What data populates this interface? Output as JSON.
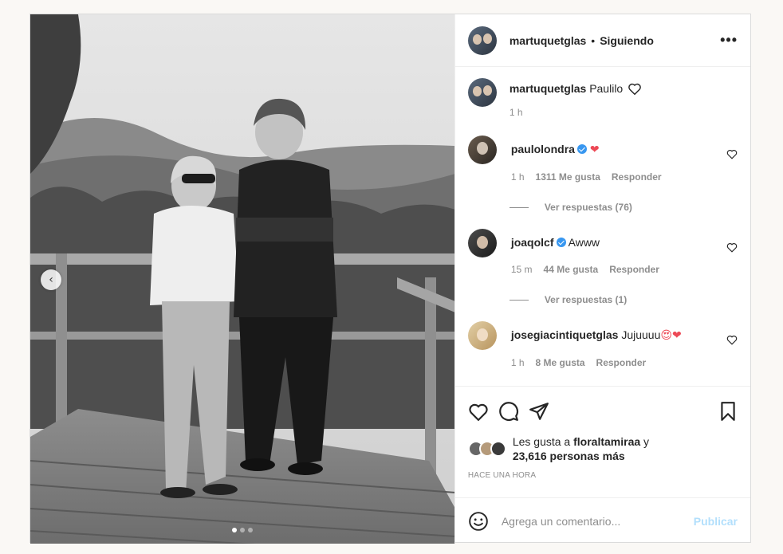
{
  "header": {
    "username": "martuquetglas",
    "separator": "•",
    "follow_status": "Siguiendo",
    "more_icon": "more-horizontal-icon"
  },
  "caption": {
    "username": "martuquetglas",
    "text": "Paulilo",
    "time": "1 h"
  },
  "comments": [
    {
      "username": "paulolondra",
      "verified": true,
      "text": "",
      "emoji": "❤",
      "time": "1 h",
      "likes": "1311 Me gusta",
      "reply": "Responder",
      "view_replies": "Ver respuestas (76)"
    },
    {
      "username": "joaqolcf",
      "verified": true,
      "text": "Awww",
      "time": "15 m",
      "likes": "44 Me gusta",
      "reply": "Responder",
      "view_replies": "Ver respuestas (1)"
    },
    {
      "username": "josegiacintiquetglas",
      "verified": false,
      "text": "Jujuuuu",
      "emoji": "😍❤",
      "time": "1 h",
      "likes": "8 Me gusta",
      "reply": "Responder"
    }
  ],
  "likes": {
    "prefix": "Les gusta a",
    "user": "floraltamiraa",
    "suffix_1": "y",
    "count": "23,616 personas más"
  },
  "posted": "HACE UNA HORA",
  "comment_box": {
    "placeholder": "Agrega un comentario...",
    "publish": "Publicar"
  },
  "carousel": {
    "prev_label": "‹",
    "slides": 3,
    "active": 1
  },
  "colors": {
    "verified": "#3897f0",
    "heart": "#ed4956",
    "publish_disabled": "#b2dffc",
    "secondary_text": "#8e8e8e"
  }
}
